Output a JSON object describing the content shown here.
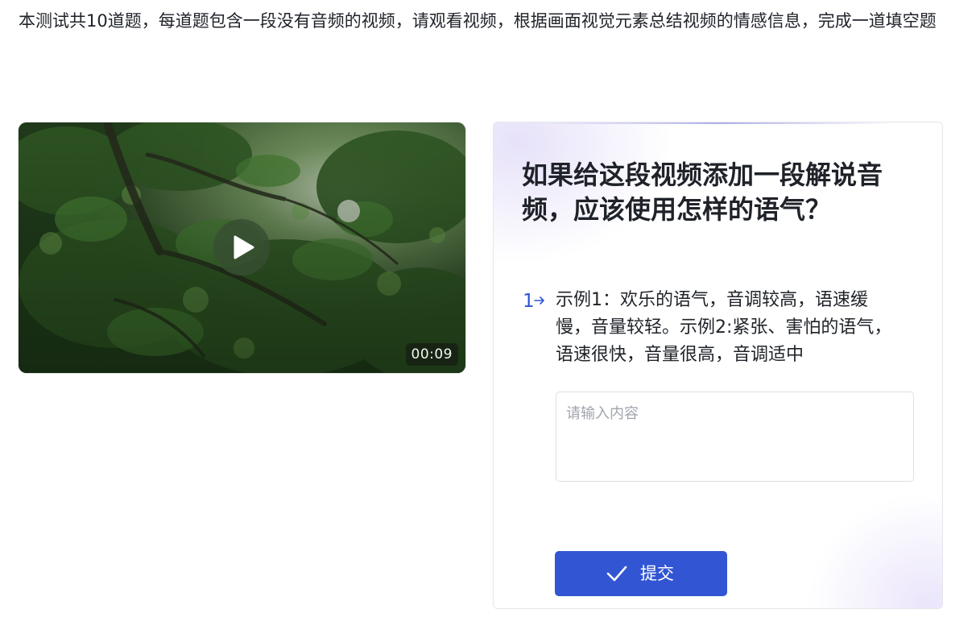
{
  "intro": "本测试共10道题，每道题包含一段没有音频的视频，请观看视频，根据画面视觉元素总结视频的情感信息，完成一道填空题",
  "video": {
    "duration": "00:09",
    "play_icon": "play-icon"
  },
  "question": {
    "title": "如果给这段视频添加一段解说音频，应该使用怎样的语气？",
    "number": "1",
    "prompt": "示例1：欢乐的语气，音调较高，语速缓慢，音量较轻。示例2:紧张、害怕的语气，语速很快，音量很高，音调适中",
    "input_placeholder": "请输入内容",
    "input_value": ""
  },
  "submit": {
    "label": "提交",
    "icon": "check-icon"
  },
  "colors": {
    "accent": "#3255d3",
    "number": "#2d55d6",
    "text": "#1f2329"
  }
}
